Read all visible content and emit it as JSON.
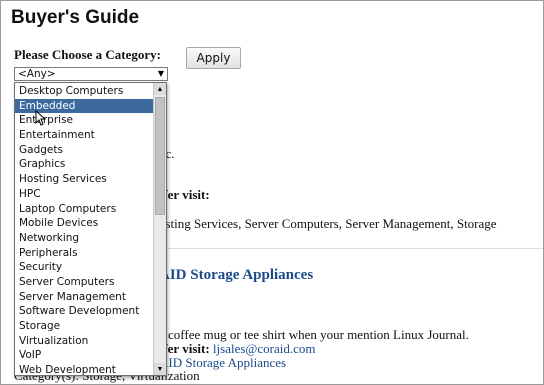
{
  "page": {
    "title": "Buyer's Guide"
  },
  "filter": {
    "label": "Please Choose a Category:",
    "selected": "<Any>",
    "apply_label": "Apply"
  },
  "dropdown": {
    "highlighted": "Embedded",
    "options": [
      "Desktop Computers",
      "Embedded",
      "Enterprise",
      "Entertainment",
      "Gadgets",
      "Graphics",
      "Hosting Services",
      "HPC",
      "Laptop Computers",
      "Mobile Devices",
      "Networking",
      "Peripherals",
      "Security",
      "Server Computers",
      "Server Management",
      "Software Development",
      "Storage",
      "Virtualization",
      "VoIP",
      "Web Development"
    ]
  },
  "background": {
    "company_suffix": "nc.",
    "offer_label_1": "ffer visit:",
    "categories_line": "osting Services, Server Computers, Server Management, Storage",
    "entry_heading": "AID Storage Appliances",
    "promo_line": "e coffee mug or tee shirt when your mention Linux Journal.",
    "offer_label_2": "ffer visit:",
    "offer_email": "ljsales@coraid.com",
    "product_link": "AID Storage Appliances",
    "category_line": "Category(s): Storage, Virtualization"
  },
  "colors": {
    "link": "#1b4a8c",
    "highlight": "#3c6a9e"
  },
  "icons": {
    "select": "dropdown-arrow-icon",
    "scroll_up": "scroll-up-arrow-icon",
    "scroll_down": "scroll-down-arrow-icon",
    "cursor": "mouse-pointer-icon"
  }
}
